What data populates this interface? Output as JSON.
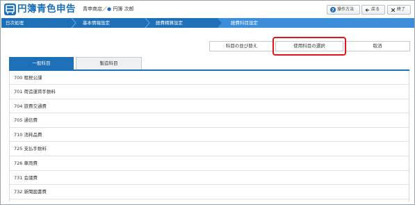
{
  "app": {
    "logo_text": "円簿青色申告",
    "company": "青申商店",
    "separator": "／",
    "user": "円簿 次郎"
  },
  "header_buttons": {
    "help": "操作方法",
    "back": "戻る",
    "close": "終了"
  },
  "nav": {
    "steps": [
      {
        "label": "日次処理"
      },
      {
        "label": "基本情報設定"
      },
      {
        "label": "経費精算設定"
      },
      {
        "label": "経費科目設定"
      }
    ],
    "active_index": 3
  },
  "actions": {
    "sort": "科目の並び替え",
    "select_used": "使用科目の選択",
    "cancel": "取消"
  },
  "tabs": {
    "general": "一般科目",
    "manufacturing": "製造科目"
  },
  "accounts": [
    {
      "label": "700 租税公課"
    },
    {
      "label": "701 荷造運賃手数料"
    },
    {
      "label": "704 旅費交通費"
    },
    {
      "label": "705 通信費"
    },
    {
      "label": "710 消耗品費"
    },
    {
      "label": "725 支払手数料"
    },
    {
      "label": "726 車両費"
    },
    {
      "label": "731 会議費"
    },
    {
      "label": "732 新聞図書費"
    }
  ],
  "colors": {
    "brand": "#1d6fb8",
    "active_step": "#3d8ed8",
    "highlight": "#e2141a"
  }
}
